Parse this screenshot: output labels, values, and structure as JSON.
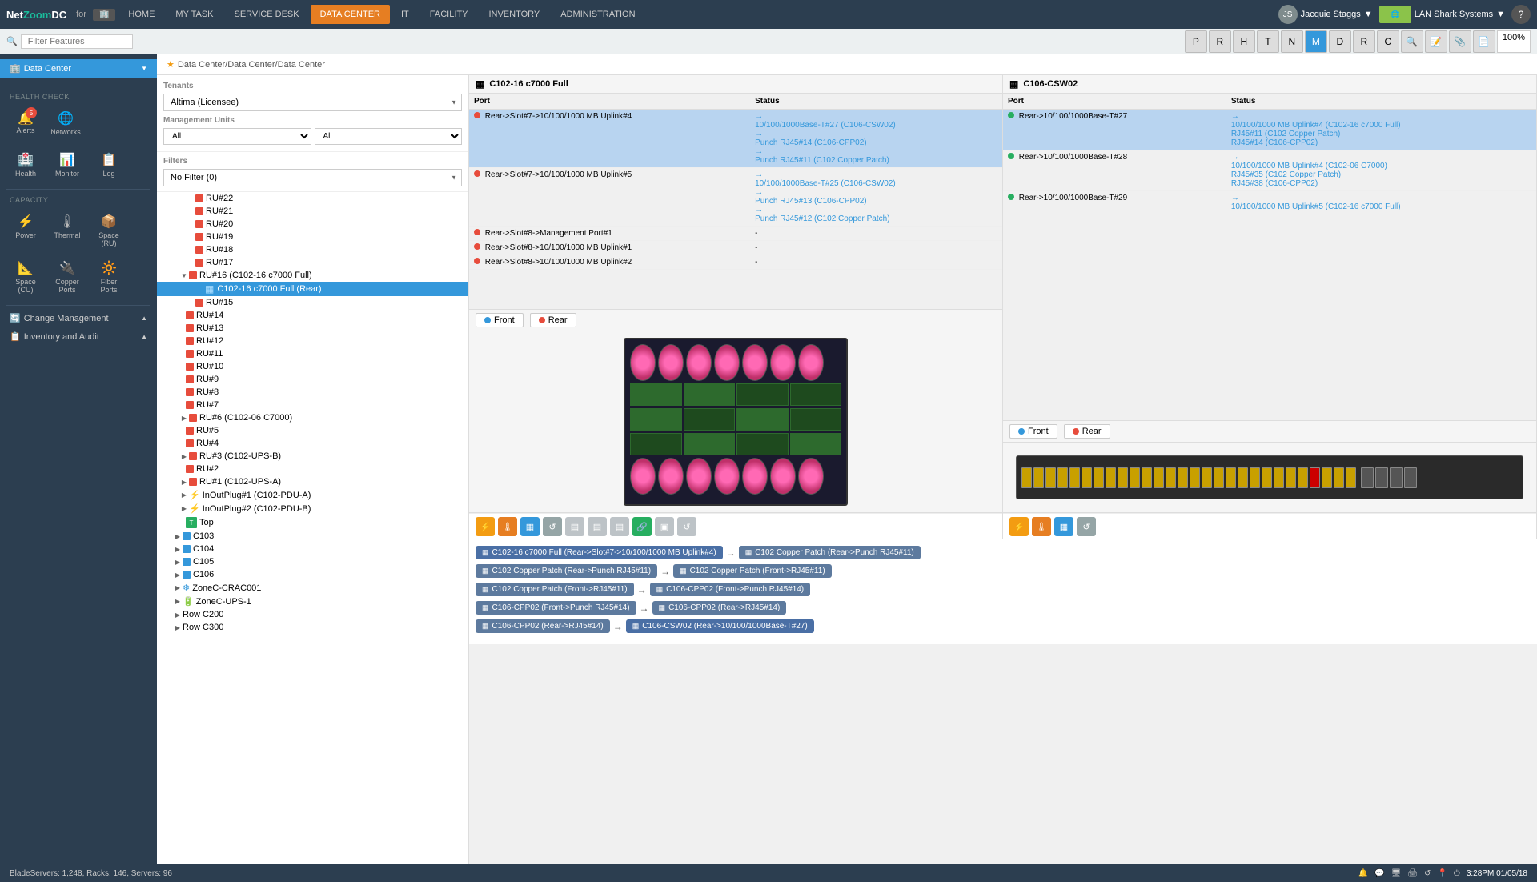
{
  "app": {
    "title": "NetZoomDC",
    "for_text": "for",
    "company": "LAN Shark Systems"
  },
  "top_nav": {
    "items": [
      {
        "label": "HOME",
        "active": false
      },
      {
        "label": "MY TASK",
        "active": false
      },
      {
        "label": "SERVICE DESK",
        "active": false
      },
      {
        "label": "DATA CENTER",
        "active": true
      },
      {
        "label": "IT",
        "active": false
      },
      {
        "label": "FACILITY",
        "active": false
      },
      {
        "label": "INVENTORY",
        "active": false
      },
      {
        "label": "ADMINISTRATION",
        "active": false
      }
    ],
    "user": "Jacquie Staggs",
    "zoom": "100%"
  },
  "sidebar": {
    "filter_placeholder": "Filter Features",
    "data_center_label": "Data Center",
    "health_check_label": "HEALTH CHECK",
    "health_items": [
      {
        "label": "Health",
        "icon": "🏥"
      },
      {
        "label": "Monitor",
        "icon": "📊"
      },
      {
        "label": "Log",
        "icon": "📋"
      }
    ],
    "capacity_label": "CAPACITY",
    "capacity_items": [
      {
        "label": "Power",
        "icon": "⚡"
      },
      {
        "label": "Thermal",
        "icon": "🌡"
      },
      {
        "label": "Space (RU)",
        "icon": "📦"
      },
      {
        "label": "Space (CU)",
        "icon": "📐"
      },
      {
        "label": "Copper Ports",
        "icon": "🔌"
      },
      {
        "label": "Fiber Ports",
        "icon": "🔆"
      }
    ],
    "alerts_label": "Alerts",
    "networks_label": "Networks",
    "alerts_badge": "5",
    "change_management": "Change Management",
    "inventory_audit": "Inventory and Audit"
  },
  "breadcrumb": "Data Center/Data Center/Data Center",
  "tenants": {
    "label": "Tenants",
    "selected": "Altima (Licensee)",
    "management_units_label": "Management Units",
    "mgmt_left": "All",
    "mgmt_right": "All",
    "filters_label": "Filters",
    "filter_selected": "No Filter (0)"
  },
  "tree_items": [
    {
      "label": "RU#22",
      "level": 2,
      "color": "#e74c3c"
    },
    {
      "label": "RU#21",
      "level": 2,
      "color": "#e74c3c"
    },
    {
      "label": "RU#20",
      "level": 2,
      "color": "#e74c3c"
    },
    {
      "label": "RU#19",
      "level": 2,
      "color": "#e74c3c"
    },
    {
      "label": "RU#18",
      "level": 2,
      "color": "#e74c3c"
    },
    {
      "label": "RU#17",
      "level": 2,
      "color": "#e74c3c"
    },
    {
      "label": "RU#16 (C102-16 c7000 Full)",
      "level": 2,
      "expanded": true,
      "color": "#e74c3c"
    },
    {
      "label": "C102-16 c7000 Full (Rear)",
      "level": 3,
      "selected": true,
      "color": "#555"
    },
    {
      "label": "RU#15",
      "level": 2,
      "color": "#e74c3c"
    },
    {
      "label": "RU#14",
      "level": 2,
      "color": "#e74c3c"
    },
    {
      "label": "RU#13",
      "level": 2,
      "color": "#e74c3c"
    },
    {
      "label": "RU#12",
      "level": 2,
      "color": "#e74c3c"
    },
    {
      "label": "RU#11",
      "level": 2,
      "color": "#e74c3c"
    },
    {
      "label": "RU#10",
      "level": 2,
      "color": "#e74c3c"
    },
    {
      "label": "RU#9",
      "level": 2,
      "color": "#e74c3c"
    },
    {
      "label": "RU#8",
      "level": 2,
      "color": "#e74c3c"
    },
    {
      "label": "RU#7",
      "level": 2,
      "color": "#e74c3c"
    },
    {
      "label": "RU#6 (C102-06 C7000)",
      "level": 2,
      "color": "#e74c3c"
    },
    {
      "label": "RU#5",
      "level": 2,
      "color": "#e74c3c"
    },
    {
      "label": "RU#4",
      "level": 2,
      "color": "#e74c3c"
    },
    {
      "label": "RU#3 (C102-UPS-B)",
      "level": 2,
      "color": "#e74c3c"
    },
    {
      "label": "RU#2",
      "level": 2,
      "color": "#e74c3c"
    },
    {
      "label": "RU#1 (C102-UPS-A)",
      "level": 2,
      "color": "#e74c3c"
    },
    {
      "label": "InOutPlug#1 (C102-PDU-A)",
      "level": 2,
      "color": "#e74c3c"
    },
    {
      "label": "InOutPlug#2 (C102-PDU-B)",
      "level": 2,
      "color": "#e74c3c"
    },
    {
      "label": "Top",
      "level": 2,
      "icon": "T"
    },
    {
      "label": "C103",
      "level": 1,
      "color": "#3498db"
    },
    {
      "label": "C104",
      "level": 1,
      "color": "#3498db"
    },
    {
      "label": "C105",
      "level": 1,
      "color": "#3498db"
    },
    {
      "label": "C106",
      "level": 1,
      "color": "#3498db"
    },
    {
      "label": "ZoneC-CRAC001",
      "level": 1,
      "icon": "❄"
    },
    {
      "label": "ZoneC-UPS-1",
      "level": 1,
      "icon": "🔋"
    },
    {
      "label": "Row C200",
      "level": 1
    },
    {
      "label": "Row C300",
      "level": 1
    }
  ],
  "left_panel": {
    "title": "C102-16 c7000 Full",
    "front_label": "Front",
    "rear_label": "Rear",
    "columns": {
      "port": "Port",
      "status": "Status"
    },
    "ports": [
      {
        "port": "Rear->Slot#7->10/100/1000 MB Uplink#4",
        "status_links": [
          "10/100/1000Base-T#27 (C106-CSW02)",
          "Punch RJ45#14 (C106-CPP02)",
          "Punch RJ45#11 (C102 Copper Patch)"
        ],
        "selected": true
      },
      {
        "port": "Rear->Slot#7->10/100/1000 MB Uplink#5",
        "status_links": [
          "10/100/1000Base-T#25 (C106-CSW02)",
          "Punch RJ45#13 (C106-CPP02)",
          "Punch RJ45#12 (C102 Copper Patch)"
        ]
      },
      {
        "port": "Rear->Slot#8->Management Port#1",
        "status_links": []
      },
      {
        "port": "Rear->Slot#8->10/100/1000 MB Uplink#1",
        "status_links": []
      },
      {
        "port": "Rear->Slot#8->10/100/1000 MB Uplink#2",
        "status_links": []
      }
    ]
  },
  "right_panel": {
    "title": "C106-CSW02",
    "front_label": "Front",
    "rear_label": "Rear",
    "ports": [
      {
        "port": "Rear->10/100/1000Base-T#27",
        "status_links": [
          "10/100/1000 MB Uplink#4 (C102-16 c7000 Full)",
          "RJ45#11 (C102 Copper Patch)",
          "RJ45#14 (C106-CPP02)"
        ],
        "selected": true
      },
      {
        "port": "Rear->10/100/1000Base-T#28",
        "status_links": [
          "10/100/1000 MB Uplink#4 (C102-06 C7000)",
          "RJ45#35 (C102 Copper Patch)",
          "RJ45#38 (C106-CPP02)"
        ]
      },
      {
        "port": "Rear->10/100/1000Base-T#29",
        "status_links": [
          "10/100/1000 MB Uplink#5 (C102-16 c7000 Full)"
        ]
      }
    ]
  },
  "trace_paths": [
    {
      "nodes": [
        {
          "label": "C102-16 c7000 Full (Rear->Slot#7->10/100/1000 MB Uplink#4)",
          "type": "device"
        },
        {
          "label": "C102 Copper Patch (Rear->Punch RJ45#11)",
          "type": "patch"
        }
      ]
    },
    {
      "nodes": [
        {
          "label": "C102 Copper Patch (Rear->Punch RJ45#11)",
          "type": "patch"
        },
        {
          "label": "C102 Copper Patch (Front->RJ45#11)",
          "type": "patch"
        }
      ]
    },
    {
      "nodes": [
        {
          "label": "C102 Copper Patch (Front->RJ45#11)",
          "type": "patch"
        },
        {
          "label": "C106-CPP02 (Front->Punch RJ45#14)",
          "type": "patch"
        }
      ]
    },
    {
      "nodes": [
        {
          "label": "C106-CPP02 (Front->Punch RJ45#14)",
          "type": "patch"
        },
        {
          "label": "C106-CPP02 (Rear->RJ45#14)",
          "type": "patch"
        }
      ]
    },
    {
      "nodes": [
        {
          "label": "C106-CPP02 (Rear->RJ45#14)",
          "type": "patch"
        },
        {
          "label": "C106-CSW02 (Rear->10/100/1000Base-T#27)",
          "type": "switch"
        }
      ]
    }
  ],
  "status_bar": {
    "text": "BladeServers: 1,248, Racks: 146, Servers: 96",
    "time": "3:28PM",
    "date": "01/05/18"
  },
  "toolbar_icons": [
    {
      "name": "property",
      "label": "Property"
    },
    {
      "name": "room",
      "label": "Room"
    },
    {
      "name": "health",
      "label": "Health"
    },
    {
      "name": "trace",
      "label": "Trace"
    },
    {
      "name": "network",
      "label": "Network"
    },
    {
      "name": "map",
      "label": "Map"
    },
    {
      "name": "dash",
      "label": "Dash"
    },
    {
      "name": "report",
      "label": "Report"
    },
    {
      "name": "charts",
      "label": "Charts"
    }
  ]
}
